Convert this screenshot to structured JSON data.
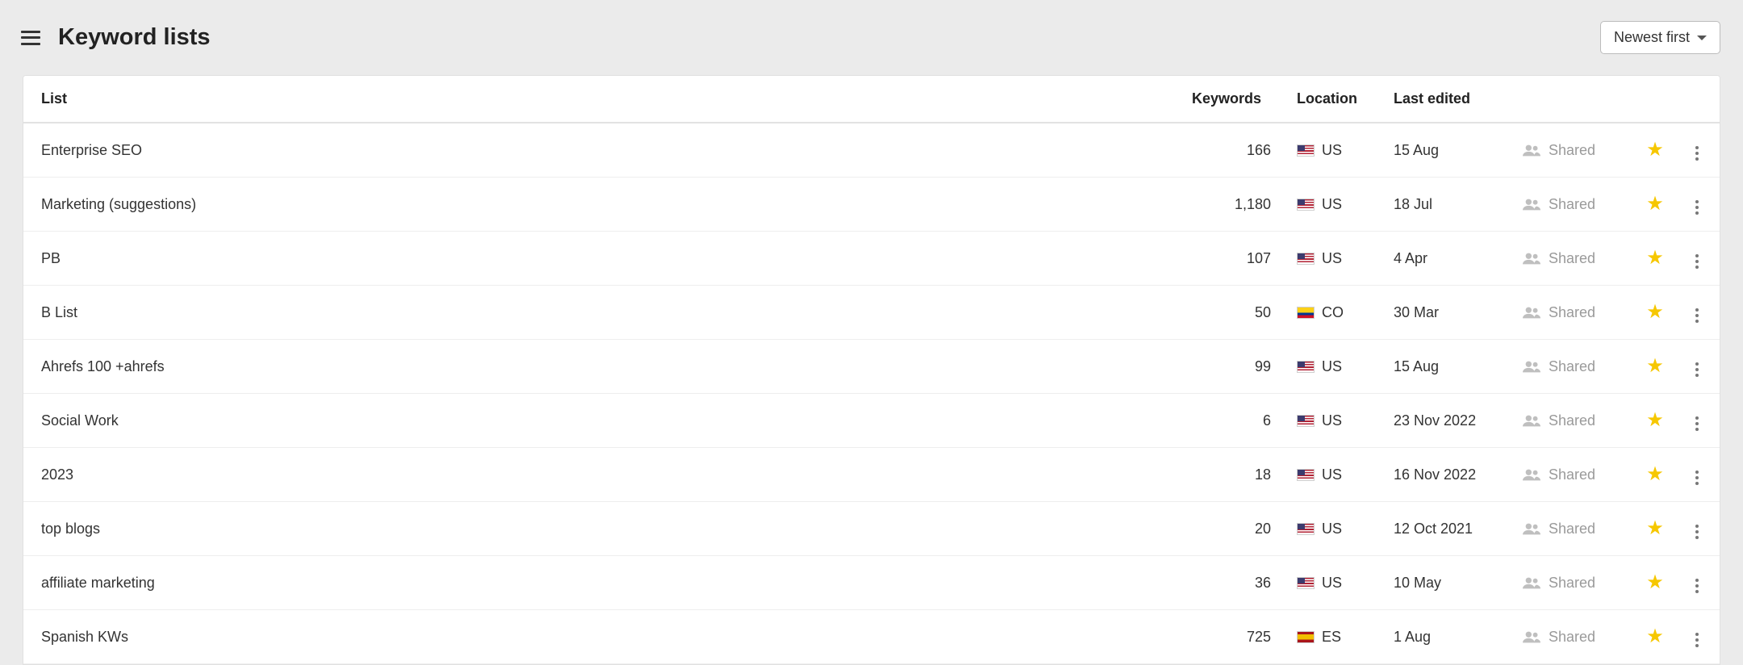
{
  "header": {
    "title": "Keyword lists",
    "sort_label": "Newest first"
  },
  "shared_label": "Shared",
  "columns": {
    "list": "List",
    "keywords": "Keywords",
    "location": "Location",
    "last_edited": "Last edited"
  },
  "rows": [
    {
      "name": "Enterprise SEO",
      "keywords": "166",
      "flag": "us",
      "country": "US",
      "last_edited": "15 Aug",
      "shared": true,
      "starred": true
    },
    {
      "name": "Marketing (suggestions)",
      "keywords": "1,180",
      "flag": "us",
      "country": "US",
      "last_edited": "18 Jul",
      "shared": true,
      "starred": true
    },
    {
      "name": "PB",
      "keywords": "107",
      "flag": "us",
      "country": "US",
      "last_edited": "4 Apr",
      "shared": true,
      "starred": true
    },
    {
      "name": "B List",
      "keywords": "50",
      "flag": "co",
      "country": "CO",
      "last_edited": "30 Mar",
      "shared": true,
      "starred": true
    },
    {
      "name": "Ahrefs 100 +ahrefs",
      "keywords": "99",
      "flag": "us",
      "country": "US",
      "last_edited": "15 Aug",
      "shared": true,
      "starred": true
    },
    {
      "name": "Social Work",
      "keywords": "6",
      "flag": "us",
      "country": "US",
      "last_edited": "23 Nov 2022",
      "shared": true,
      "starred": true
    },
    {
      "name": "2023",
      "keywords": "18",
      "flag": "us",
      "country": "US",
      "last_edited": "16 Nov 2022",
      "shared": true,
      "starred": true
    },
    {
      "name": "top blogs",
      "keywords": "20",
      "flag": "us",
      "country": "US",
      "last_edited": "12 Oct 2021",
      "shared": true,
      "starred": true
    },
    {
      "name": "affiliate marketing",
      "keywords": "36",
      "flag": "us",
      "country": "US",
      "last_edited": "10 May",
      "shared": true,
      "starred": true
    },
    {
      "name": "Spanish KWs",
      "keywords": "725",
      "flag": "es",
      "country": "ES",
      "last_edited": "1 Aug",
      "shared": true,
      "starred": true
    }
  ]
}
